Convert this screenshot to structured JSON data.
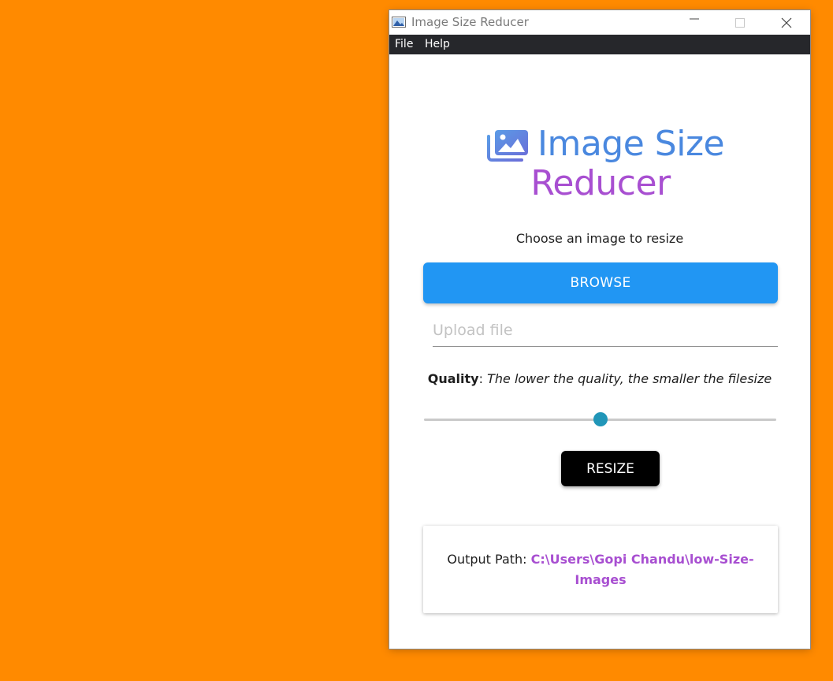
{
  "window": {
    "title": "Image Size Reducer"
  },
  "menu": {
    "items": [
      "File",
      "Help"
    ]
  },
  "hero": {
    "title_line1": "Image Size",
    "title_line2": "Reducer",
    "icon": "images-icon",
    "color_line1": "#4a88df",
    "color_line2": "#a84fd1"
  },
  "main": {
    "choose_label": "Choose an image to resize",
    "browse_label": "BROWSE",
    "upload_placeholder": "Upload file",
    "quality_label": "Quality",
    "quality_hint": "The lower the quality, the smaller the filesize",
    "quality_fraction": 0.5,
    "resize_label": "RESIZE"
  },
  "output": {
    "label": "Output Path: ",
    "path": "C:\\Users\\Gopi Chandu\\low-Size-Images"
  },
  "colors": {
    "background": "#FF8A00",
    "browse_button": "#2196F3",
    "resize_button": "#000000",
    "slider_thumb": "#2196b8",
    "menubar": "#26272b"
  }
}
